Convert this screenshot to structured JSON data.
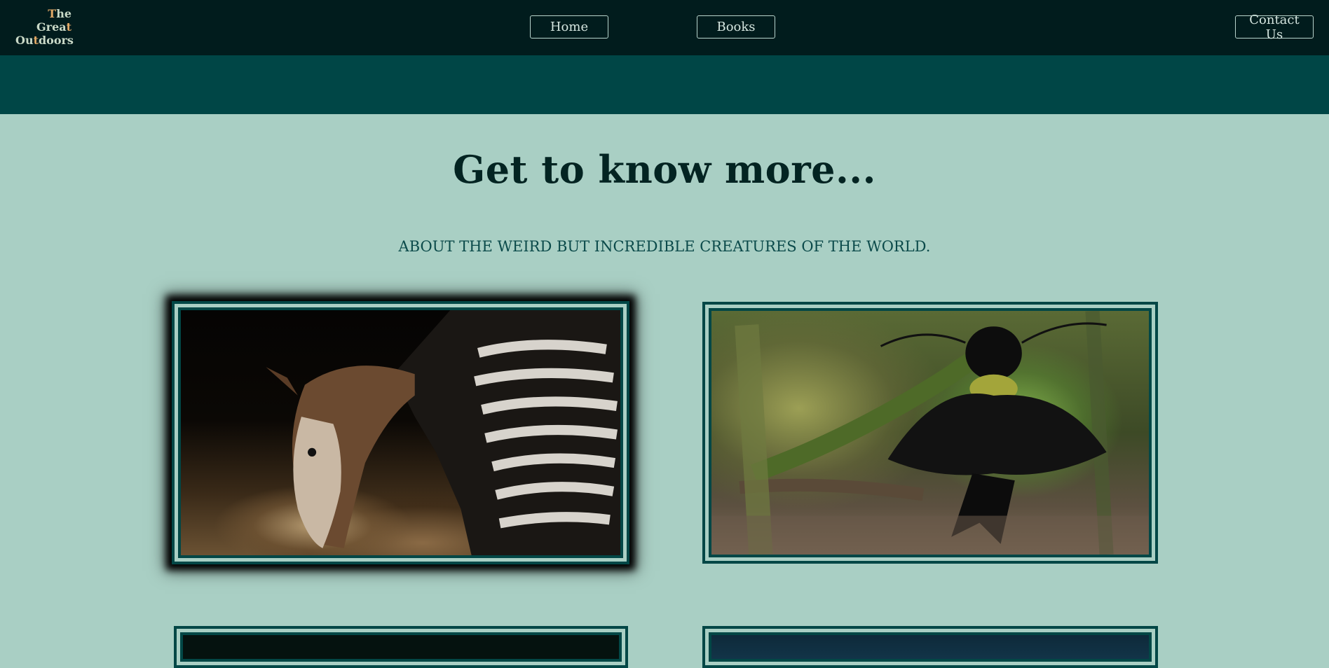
{
  "header": {
    "logo": {
      "line1": {
        "a": "T",
        "b": "he"
      },
      "line2": {
        "a": "Grea",
        "b": "t"
      },
      "line3": {
        "a": "Ou",
        "b": "t",
        "c": "doors"
      }
    },
    "nav": {
      "home_label": "Home",
      "books_label": "Books",
      "contact_label": "Contact Us"
    }
  },
  "main": {
    "title": "Get to know more...",
    "subtitle": "ABOUT THE WEIRD BUT INCREDIBLE CREATURES OF THE WORLD."
  },
  "gallery": {
    "images": [
      {
        "subject": "okapi"
      },
      {
        "subject": "bird of paradise"
      },
      {
        "subject": "unknown"
      },
      {
        "subject": "unknown"
      }
    ]
  },
  "colors": {
    "topbar": "#011c1d",
    "band": "#004646",
    "page_bg": "#a9cfc4",
    "frame_border": "#024746",
    "title": "#032422",
    "logo_accent": "#e0a866"
  }
}
